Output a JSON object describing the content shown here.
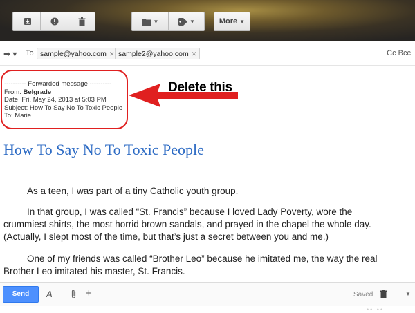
{
  "toolbar": {
    "buttons": [
      {
        "name": "archive-icon"
      },
      {
        "name": "report-spam-icon"
      },
      {
        "name": "delete-icon"
      },
      {
        "name": "move-to-icon"
      },
      {
        "name": "labels-icon"
      }
    ],
    "more_label": "More",
    "background_color": "#3a3224"
  },
  "recipients": {
    "to_label": "To",
    "chips": [
      "sample@yahoo.com",
      "sample2@yahoo.com"
    ],
    "cc_bcc": "Cc Bcc"
  },
  "forwarded": {
    "separator": "---------- Forwarded message ----------",
    "from_label": "From: ",
    "from_value": "Belgrade",
    "date": "Date: Fri, May 24, 2013 at 5:03 PM",
    "subject": "Subject: How To Say No To Toxic People",
    "to": "To: Marie"
  },
  "annotation": {
    "text": "Delete this",
    "color": "#e02020"
  },
  "article": {
    "title": "How To Say No To Toxic People",
    "title_color": "#2d6bc4",
    "paragraphs": [
      "As a teen, I was part of a tiny Catholic youth group.",
      "In that group, I was called “St. Francis” because I loved Lady Poverty, wore the crummiest shirts, the most horrid brown sandals, and prayed in the chapel the whole day. (Actually, I slept most of the time, but that’s just a secret between you and me.)",
      "One of my friends was called “Brother Leo” because he imitated me, the way the real Brother Leo imitated his master, St. Francis."
    ]
  },
  "compose": {
    "send_label": "Send",
    "send_color": "#4d90fe",
    "format_icon": "A",
    "add_icon": "+",
    "saved_label": "Saved"
  }
}
